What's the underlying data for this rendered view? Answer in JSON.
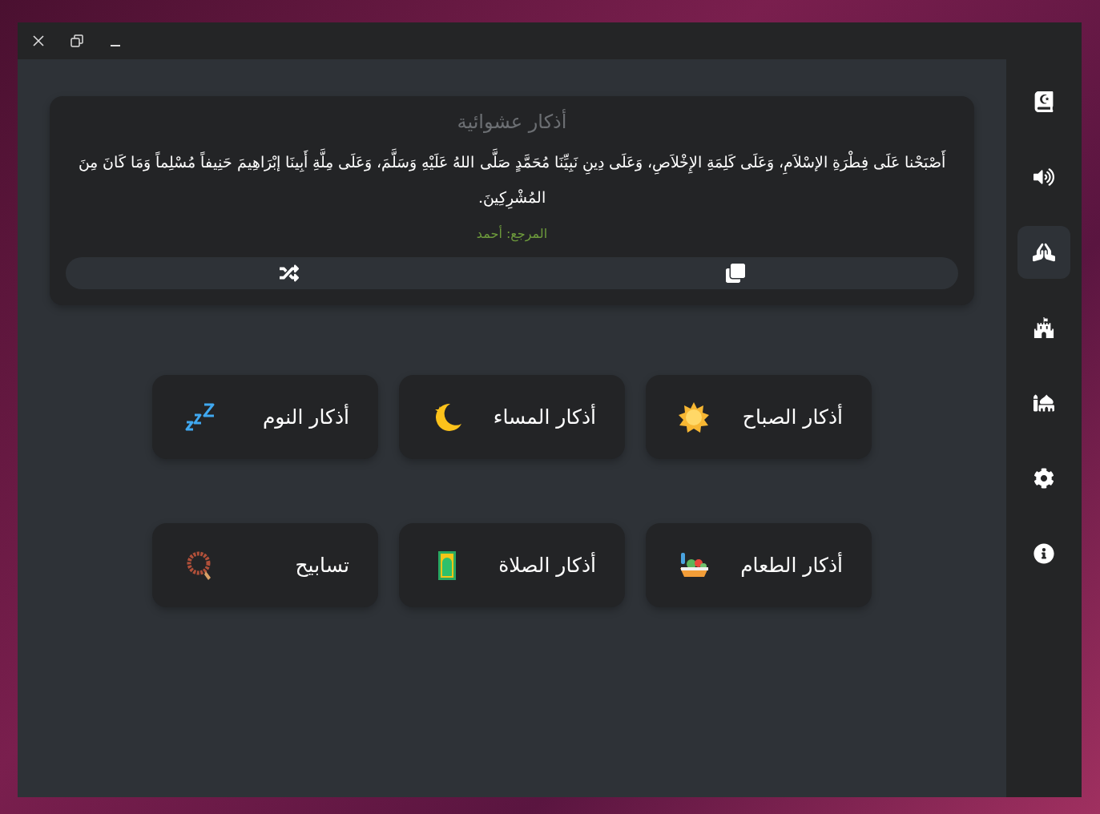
{
  "random_card": {
    "title": "أذكار عشوائية",
    "text": "أَصْبَحْنا عَلَى فِطْرَةِ الإسْلاَمِ، وَعَلَى كَلِمَةِ الإِخْلاَصِ، وَعَلَى دِينِ نَبِيِّنَا مُحَمَّدٍ صَلَّى اللهُ عَلَيْهِ وَسَلَّمَ، وَعَلَى مِلَّةِ أَبِينَا إبْرَاهِيمَ حَنِيفاً مُسْلِماً وَمَا كَانَ مِنَ المُشْرِكِينَ.",
    "reference": "المرجع: أحمد"
  },
  "categories": [
    {
      "label": "أذكار الصباح",
      "kind": "sun"
    },
    {
      "label": "أذكار المساء",
      "kind": "moon"
    },
    {
      "label": "أذكار النوم",
      "kind": "sleep"
    },
    {
      "label": "أذكار الطعام",
      "kind": "food"
    },
    {
      "label": "أذكار الصلاة",
      "kind": "rug"
    },
    {
      "label": "تسابيح",
      "kind": "beads"
    }
  ],
  "sidebar": {
    "items": [
      {
        "kind": "quran",
        "selected": false
      },
      {
        "kind": "audio",
        "selected": false
      },
      {
        "kind": "hands",
        "selected": true
      },
      {
        "kind": "fort",
        "selected": false
      },
      {
        "kind": "mosque",
        "selected": false
      },
      {
        "kind": "settings",
        "selected": false
      },
      {
        "kind": "info",
        "selected": false
      }
    ]
  }
}
